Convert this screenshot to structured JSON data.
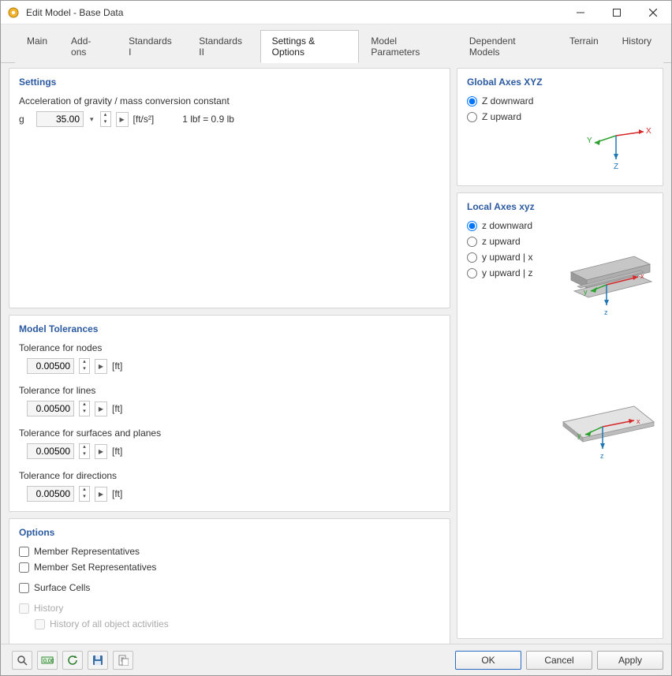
{
  "window": {
    "title": "Edit Model - Base Data"
  },
  "tabs": [
    {
      "label": "Main"
    },
    {
      "label": "Add-ons"
    },
    {
      "label": "Standards I"
    },
    {
      "label": "Standards II"
    },
    {
      "label": "Settings & Options",
      "active": true
    },
    {
      "label": "Model Parameters"
    },
    {
      "label": "Dependent Models"
    },
    {
      "label": "Terrain"
    },
    {
      "label": "History"
    }
  ],
  "settings": {
    "title": "Settings",
    "gravity_label": "Acceleration of gravity / mass conversion constant",
    "g_symbol": "g",
    "g_value": "35.00",
    "g_unit": "[ft/s²]",
    "conversion": "1 lbf = 0.9 lb"
  },
  "tolerances": {
    "title": "Model Tolerances",
    "items": [
      {
        "label": "Tolerance for nodes",
        "value": "0.00500",
        "unit": "[ft]"
      },
      {
        "label": "Tolerance for lines",
        "value": "0.00500",
        "unit": "[ft]"
      },
      {
        "label": "Tolerance for surfaces and planes",
        "value": "0.00500",
        "unit": "[ft]"
      },
      {
        "label": "Tolerance for directions",
        "value": "0.00500",
        "unit": "[ft]"
      }
    ]
  },
  "options": {
    "title": "Options",
    "member_rep": "Member Representatives",
    "member_set_rep": "Member Set Representatives",
    "surface_cells": "Surface Cells",
    "history": "History",
    "history_all": "History of all object activities"
  },
  "global_axes": {
    "title": "Global Axes XYZ",
    "z_down": "Z downward",
    "z_up": "Z upward"
  },
  "local_axes": {
    "title": "Local Axes xyz",
    "z_down": "z downward",
    "z_up": "z upward",
    "y_up_x": "y upward | x",
    "y_up_z": "y upward | z"
  },
  "footer": {
    "ok": "OK",
    "cancel": "Cancel",
    "apply": "Apply"
  },
  "icons": {
    "search": "search-icon",
    "units": "units-icon",
    "refresh": "refresh-icon",
    "save": "save-icon",
    "report": "report-icon"
  }
}
